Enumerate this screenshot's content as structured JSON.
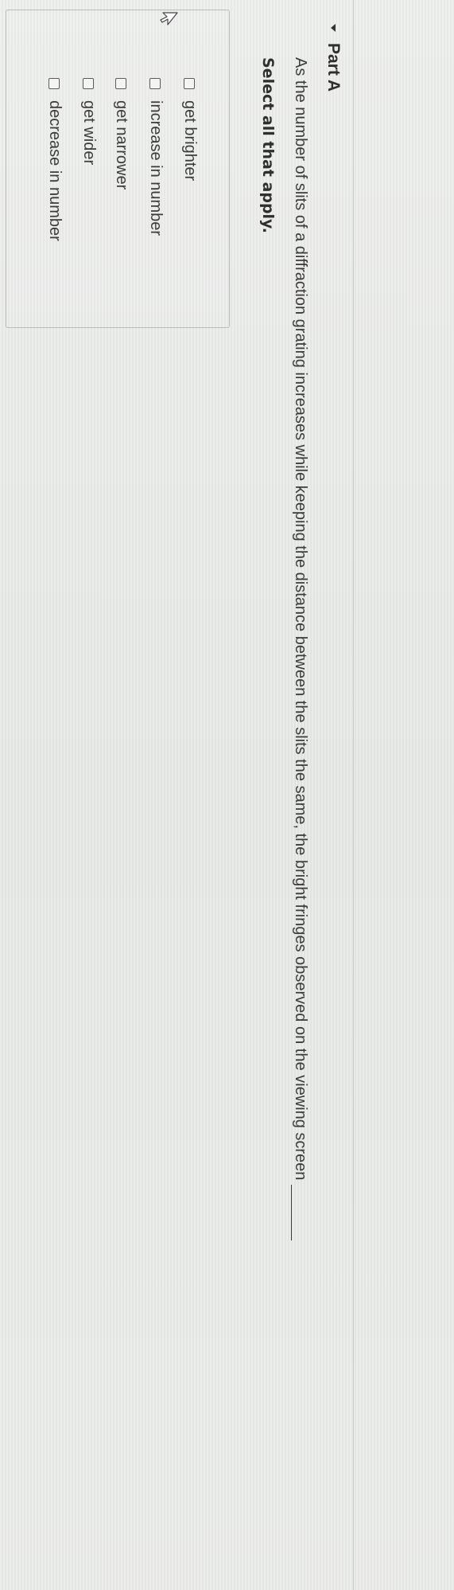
{
  "part": {
    "title": "Part A"
  },
  "question": {
    "text": "As the number of slits of a diffraction grating increases while keeping the distance between the slits the same, the bright fringes observed on the viewing screen",
    "instruction": "Select all that apply."
  },
  "options": [
    {
      "label": "get brighter",
      "checked": false
    },
    {
      "label": "increase in number",
      "checked": false
    },
    {
      "label": "get narrower",
      "checked": false
    },
    {
      "label": "get wider",
      "checked": false
    },
    {
      "label": "decrease in number",
      "checked": false
    }
  ],
  "icons": {
    "collapse": "caret-down-icon",
    "pointer": "mouse-pointer-icon"
  }
}
